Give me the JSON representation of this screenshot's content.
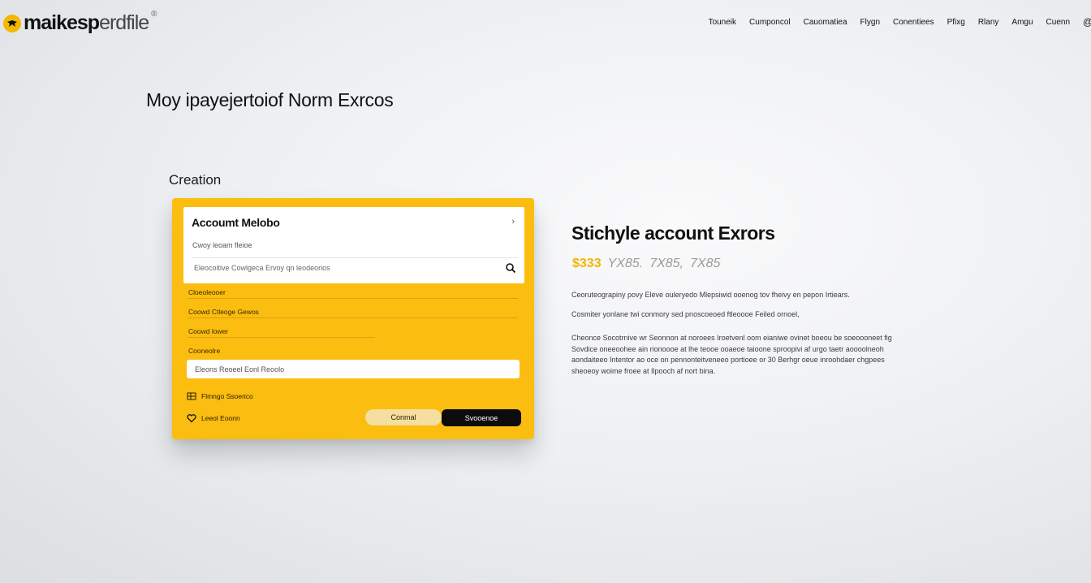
{
  "header": {
    "logo_text_bold": "maikesp",
    "logo_text_light": "erdfile",
    "logo_sup": "®",
    "nav": [
      "Touneik",
      "Cumponcol",
      "Cauomatiea",
      "Flygn",
      "Conentiees",
      "Pfixg",
      "Rlany",
      "Amgu",
      "Cuenn",
      "@"
    ]
  },
  "page": {
    "title": "Moy ipayejertoiof Norm Exrcos",
    "section_label": "Creation"
  },
  "card": {
    "title": "Accoumt Melobo",
    "chevron": "›",
    "subtitle": "Cwoy leoam fleioe",
    "search_placeholder": "Eleocoitive Cowlgeca Ervoy qn leodeorios",
    "fields": [
      {
        "label": "Cloeoleooer"
      },
      {
        "label": "Coowd Ctleoge Gewos"
      },
      {
        "label": "Coowd lower"
      },
      {
        "label": "Cooneolre"
      }
    ],
    "input_value": "Eleons Reoeel Eonl Reoolo",
    "aux_1": "Flmngo Ssoerico",
    "aux_2": "Leeol Eoonn",
    "cancel_label": "Conmal",
    "primary_label": "Svooenoe",
    "accent_color": "#fbbd10"
  },
  "right": {
    "title": "Stichyle account Exrors",
    "prices": [
      "$333",
      "YX85.",
      "7X85,",
      "7X85"
    ],
    "para_1": "Ceoruteograpiny povy Eleve ouleryedo Mlepsiwid ooenog tov fheivy en pepon Irtiears.",
    "para_2": "Cosmiter yonlane twi conmory sed pnoscoeoed ftleoooe Feiled ornoel,",
    "para_3": "Cheonce Socotrnive wr Seonnon at noroees Iroetvenl oom eianiwe ovinet boeou be soeoooneet fig Sovdice oneeoohee ain rionoooe at lhe teooe ooaeoe taioone sproopivi af urgo taetr aoooolneoh aondaiteeo Intentor ao oce on pennonteitveneeo portioee or 30 Berhgr oeue inroohdaer chgpees sheoeoy woime froee at Ilpooch af nort bina."
  }
}
